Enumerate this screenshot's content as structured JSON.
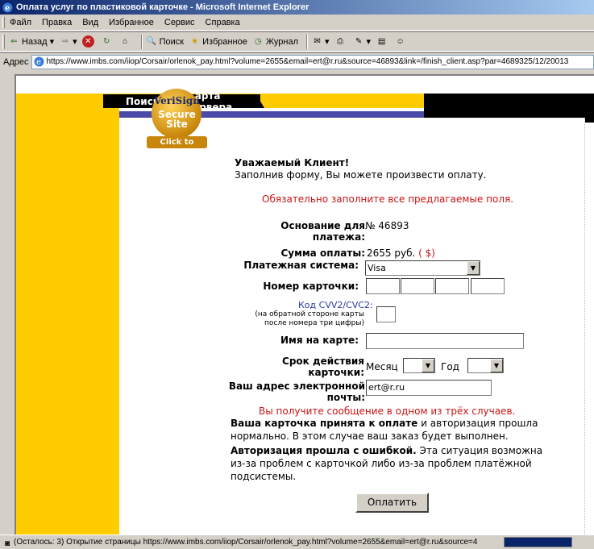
{
  "window": {
    "title": "Оплата услуг по пластиковой карточке - Microsoft Internet Explorer"
  },
  "menubar": {
    "items": [
      "Файл",
      "Правка",
      "Вид",
      "Избранное",
      "Сервис",
      "Справка"
    ]
  },
  "toolbar": {
    "back": "Назад",
    "search": "Поиск",
    "favorites": "Избранное",
    "history": "Журнал"
  },
  "address": {
    "label": "Адрес",
    "url": "https://www.imbs.com/iiop/Corsair/orlenok_pay.html?volume=2655&email=ert@r.ru&source=46893&link=/finish_client.asp?par=4689325/12/20013"
  },
  "site_nav": {
    "search": "Поиск",
    "sitemap": "Карта сервера"
  },
  "badge": {
    "name": "VeriSign",
    "secure": "Secure",
    "site": "Site",
    "click": "Click to verify"
  },
  "form": {
    "greeting": "Уважаемый Клиент!",
    "intro": "Заполнив форму, Вы можете произвести оплату.",
    "required_note": "Обязательно заполните все предлагаемые поля.",
    "basis_label": "Основание для платежа:",
    "basis_value": "№ 46893",
    "amount_label": "Сумма оплаты:",
    "amount_value": "2655 руб.",
    "amount_currency_link": "( $)",
    "system_label": "Платежная система:",
    "system_value": "Visa",
    "card_label": "Номер карточки:",
    "cvv_label": "Код CVV2/CVC2:",
    "cvv_hint": "(на обратной стороне карты после номера три цифры)",
    "name_label": "Имя на карте:",
    "expiry_label": "Срок действия карточки:",
    "month_label": "Месяц",
    "year_label": "Год",
    "email_label": "Ваш адрес электронной почты:",
    "email_value": "ert@r.ru",
    "notice": "Вы получите сообщение в одном из трёх случаев.",
    "case1_bold": "Ваша карточка принята к оплате",
    "case1_text1": " и авторизация прошла",
    "case1_text2": "нормально. В этом случае ваш заказ будет выполнен.",
    "case2_bold": "Авторизация прошла с ошибкой.",
    "case2_text1": " Эта ситуация возможна",
    "case2_text2": "из-за проблем с карточкой либо из-за проблем платёжной",
    "case2_text3": "подсистемы.",
    "submit": "Оплатить"
  },
  "status": {
    "text": "(Осталось: 3) Открытие страницы https://www.imbs.com/iiop/Corsair/orlenok_pay.html?volume=2655&email=ert@r.ru&source=4",
    "progress": 1
  },
  "colors": {
    "accent_yellow": "#ffcc00",
    "nav_blue": "#4a4aa8",
    "alert_red": "#c81414"
  }
}
